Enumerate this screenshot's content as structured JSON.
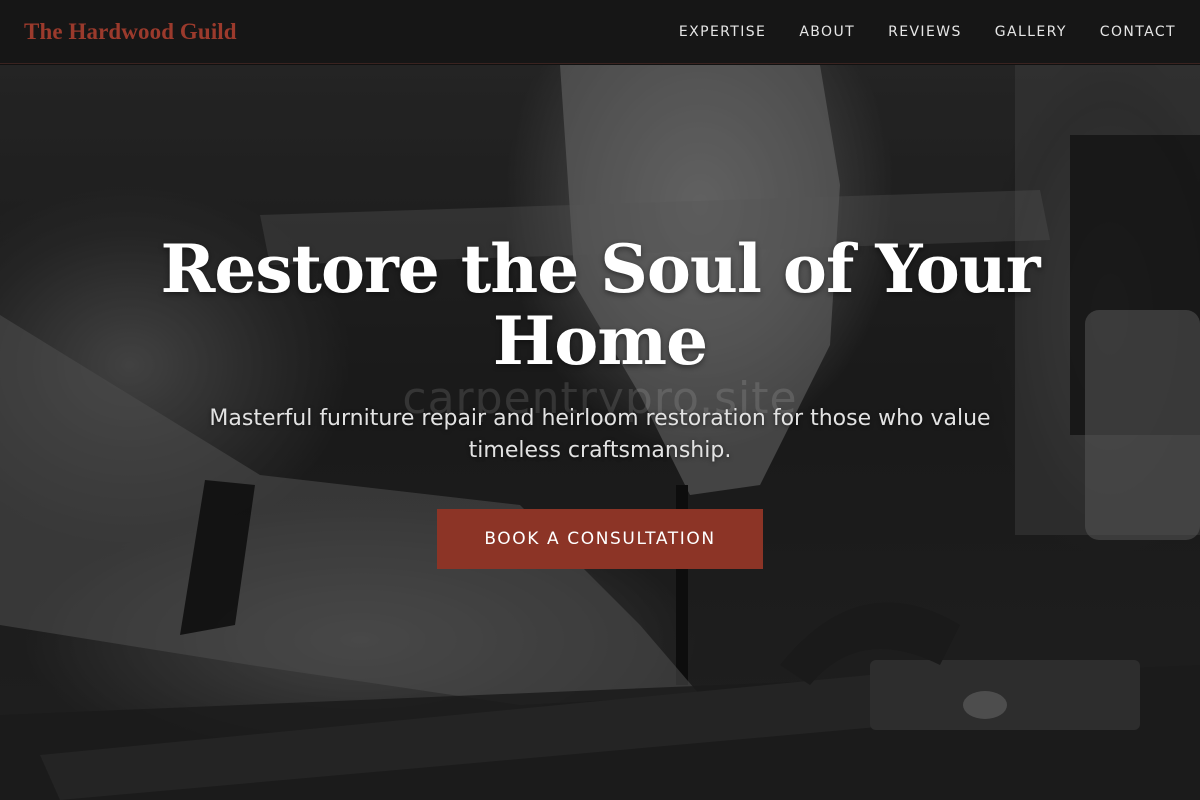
{
  "header": {
    "brand": "The Hardwood Guild",
    "nav": [
      {
        "label": "EXPERTISE"
      },
      {
        "label": "ABOUT"
      },
      {
        "label": "REVIEWS"
      },
      {
        "label": "GALLERY"
      },
      {
        "label": "CONTACT"
      }
    ]
  },
  "hero": {
    "title": "Restore the Soul of Your Home",
    "subtitle": "Masterful furniture repair and heirloom restoration for those who value timeless craftsmanship.",
    "cta_label": "BOOK A CONSULTATION",
    "watermark": "carpentrypro.site"
  },
  "colors": {
    "brand": "#9b3a2c",
    "cta_background": "#8c3426",
    "header_background": "#161616"
  }
}
